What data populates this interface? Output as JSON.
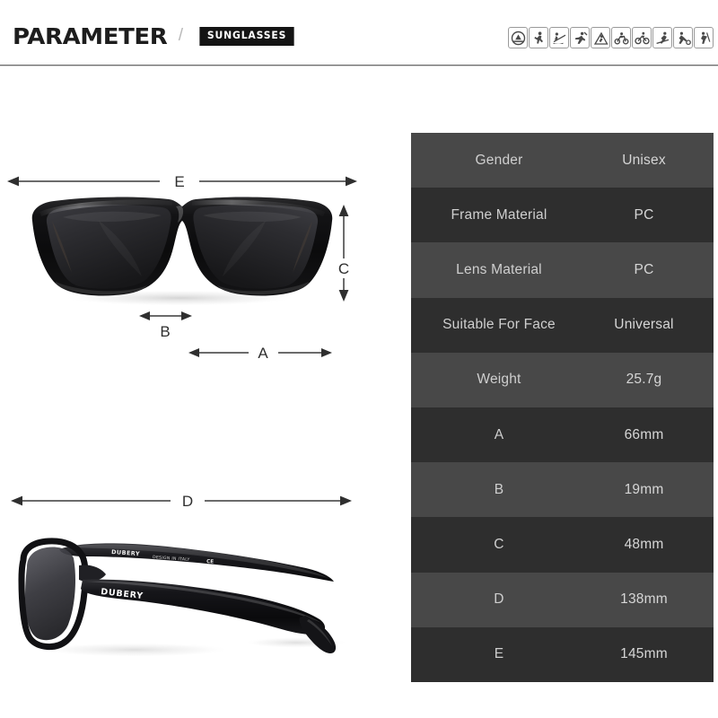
{
  "header": {
    "title": "PARAMETER",
    "separator": "/",
    "category_badge": "SUNGLASSES",
    "sport_icons": [
      "driving-icon",
      "running-icon",
      "fishing-icon",
      "baseball-icon",
      "climbing-icon",
      "motocross-icon",
      "cycling-icon",
      "skiing-icon",
      "soccer-icon",
      "golf-icon"
    ]
  },
  "diagrams": {
    "front_view": {
      "name": "sunglasses-front-view",
      "dimension_labels": {
        "E": "E",
        "C": "C",
        "B": "B",
        "A": "A"
      }
    },
    "side_view": {
      "name": "sunglasses-side-view",
      "dimension_labels": {
        "D": "D"
      },
      "brand_text": "DUBERY",
      "temple_text": "DESIGN IN ITALY",
      "cert_mark": "CE"
    }
  },
  "spec_table": {
    "rows": [
      {
        "label": "Gender",
        "value": "Unisex"
      },
      {
        "label": "Frame Material",
        "value": "PC"
      },
      {
        "label": "Lens Material",
        "value": "PC"
      },
      {
        "label": "Suitable For Face",
        "value": "Universal"
      },
      {
        "label": "Weight",
        "value": "25.7g"
      },
      {
        "label": "A",
        "value": "66mm"
      },
      {
        "label": "B",
        "value": "19mm"
      },
      {
        "label": "C",
        "value": "48mm"
      },
      {
        "label": "D",
        "value": "138mm"
      },
      {
        "label": "E",
        "value": "145mm"
      }
    ]
  },
  "colors": {
    "background": "#ffffff",
    "title_text": "#1d1d1d",
    "badge_background": "#141414",
    "badge_text": "#ffffff",
    "row_shade_light": "#484848",
    "row_shade_dark": "#2e2e2e",
    "row_label_text": "#cfcfcf",
    "row_value_text": "#d6d6d6",
    "dimension_line": "#3a3a3a",
    "frame_black": "#0d0d0d",
    "lens_gray": "#2b2b2e"
  }
}
